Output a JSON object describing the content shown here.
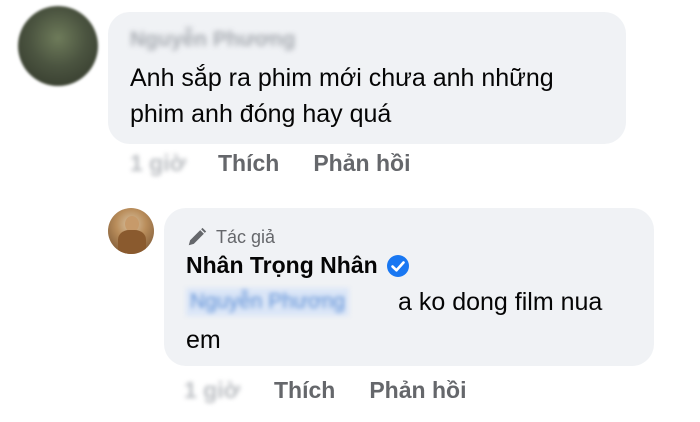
{
  "comment": {
    "author_name": "Nguyễn Phương",
    "text": "Anh sắp ra phim mới chưa anh những phim anh đóng hay quá",
    "time": "1 giờ",
    "like_label": "Thích",
    "reply_label": "Phản hồi"
  },
  "reply": {
    "author_badge_label": "Tác giả",
    "author_name": "Nhân Trọng Nhân",
    "mention": "Nguyễn Phương",
    "text_line1": "a ko dong film nua",
    "text_line2": "em",
    "time": "1 giờ",
    "like_label": "Thích",
    "reply_label": "Phản hồi"
  },
  "colors": {
    "bubble": "#f0f2f5",
    "verified_badge": "#1877f2",
    "action_text": "#65676b"
  },
  "icons": {
    "author_badge": "pencil-icon",
    "verified": "verified-check-icon"
  }
}
